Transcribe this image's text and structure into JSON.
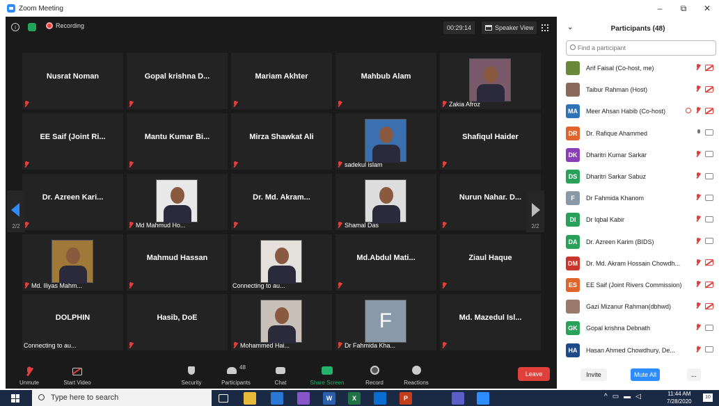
{
  "window": {
    "title": "Zoom Meeting",
    "controls": [
      "–",
      "⧉",
      "✕"
    ]
  },
  "topbar": {
    "recording": "Recording",
    "timer": "00:29:14",
    "view": "Speaker View"
  },
  "grid": [
    {
      "name": "Nusrat Noman"
    },
    {
      "name": "Gopal krishna D..."
    },
    {
      "name": "Mariam Akhter"
    },
    {
      "name": "Mahbub Alam"
    },
    {
      "label": "Zakia Afroz",
      "photo": "#7a5a6a"
    },
    {
      "name": "EE Saif (Joint Ri..."
    },
    {
      "name": "Mantu Kumar Bi..."
    },
    {
      "name": "Mirza Shawkat Ali"
    },
    {
      "label": "sadekul islam",
      "photo": "#3a6fb0"
    },
    {
      "name": "Shafiqul Haider"
    },
    {
      "name": "Dr. Azreen Kari..."
    },
    {
      "label": "Md Mahmud Ho...",
      "photo": "#e8e8e8"
    },
    {
      "name": "Dr. Md. Akram..."
    },
    {
      "label": "Shamal Das",
      "photo": "#ddd"
    },
    {
      "name": "Nurun Nahar. D..."
    },
    {
      "label": "Md. Iliyas Mahm...",
      "photo": "#a07838"
    },
    {
      "name": "Mahmud Hassan"
    },
    {
      "label": "Connecting to au...",
      "photo": "#e4e0dc",
      "connecting": true
    },
    {
      "name": "Md.Abdul  Mati..."
    },
    {
      "name": "Ziaul Haque"
    },
    {
      "name": "DOLPHIN",
      "label": "Connecting to au...",
      "connecting": true
    },
    {
      "name": "Hasib, DoE"
    },
    {
      "label": "Mohammed Hai...",
      "photo": "#c8c0b8"
    },
    {
      "label": "Dr Fahmida Kha...",
      "letter": "F"
    },
    {
      "name": "Md.  Mazedul Isl..."
    }
  ],
  "pager": {
    "left": "2/2",
    "right": "2/2"
  },
  "toolbar": {
    "unmute": "Unmute",
    "start_video": "Start Video",
    "security": "Security",
    "participants": "Participants",
    "participants_count": "48",
    "chat": "Chat",
    "share_screen": "Share Screen",
    "record": "Record",
    "reactions": "Reactions",
    "leave": "Leave"
  },
  "panel": {
    "title": "Participants (48)",
    "search_placeholder": "Find a participant",
    "participants": [
      {
        "initials": "",
        "color": "#6a8a3a",
        "name": "Arif Faisal (Co-host, me)"
      },
      {
        "initials": "",
        "color": "#8a6a5a",
        "name": "Taibur Rahman (Host)"
      },
      {
        "initials": "MA",
        "color": "#2e72b8",
        "name": "Meer Ahsan Habib (Co-host)"
      },
      {
        "initials": "DR",
        "color": "#e0652b",
        "name": "Dr. Rafique Ahammed"
      },
      {
        "initials": "DK",
        "color": "#8a3fb6",
        "name": "Dharitri Kumar Sarkar"
      },
      {
        "initials": "DS",
        "color": "#2aa15a",
        "name": "Dharitri Sarkar Sabuz"
      },
      {
        "initials": "F",
        "color": "#8a99a8",
        "name": "Dr Fahmida Khanom"
      },
      {
        "initials": "DI",
        "color": "#2aa15a",
        "name": "Dr Iqbal Kabir"
      },
      {
        "initials": "DA",
        "color": "#2aa15a",
        "name": "Dr. Azreen Karim (BIDS)"
      },
      {
        "initials": "DM",
        "color": "#c9342c",
        "name": "Dr. Md. Akram Hossain Chowdh..."
      },
      {
        "initials": "ES",
        "color": "#e0652b",
        "name": "EE Saif (Joint Rivers Commission)"
      },
      {
        "initials": "",
        "color": "#9a7a6a",
        "name": "Gazi Mizanur Rahman(dbhwd)"
      },
      {
        "initials": "GK",
        "color": "#2aa15a",
        "name": "Gopal krishna Debnath"
      },
      {
        "initials": "HA",
        "color": "#1e4a8a",
        "name": "Hasan Ahmed Chowdhury, De..."
      }
    ],
    "invite": "Invite",
    "mute_all": "Mute All",
    "more": "..."
  },
  "taskbar": {
    "search_placeholder": "Type here to search",
    "time": "11:44 AM",
    "date": "7/28/2020",
    "notifications": "10"
  }
}
